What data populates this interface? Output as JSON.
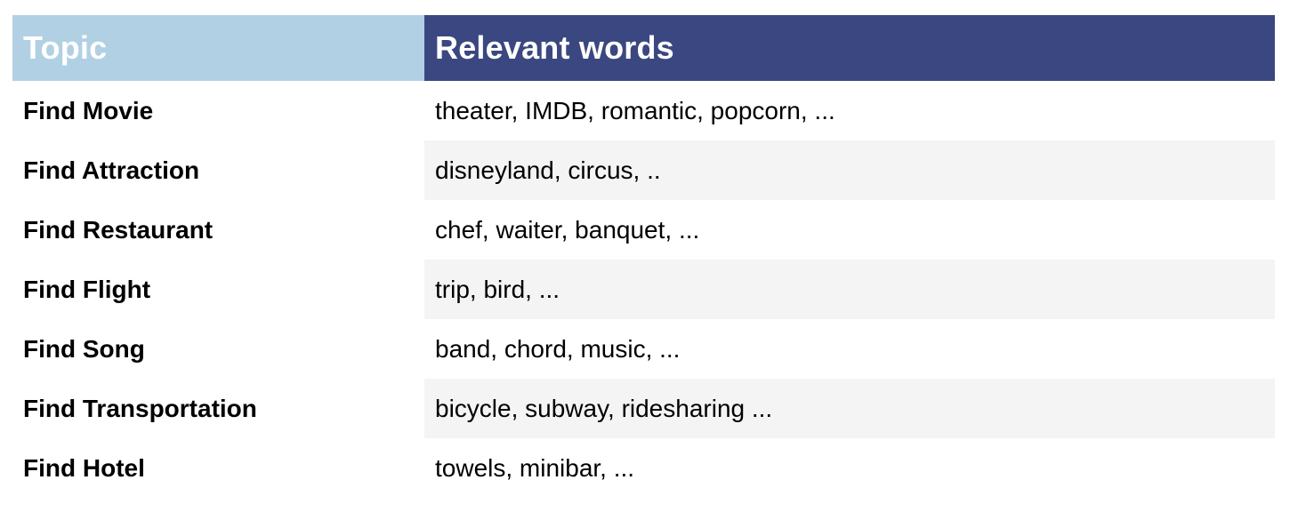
{
  "table": {
    "header": {
      "topic": "Topic",
      "words": "Relevant words"
    },
    "rows": [
      {
        "topic": "Find Movie",
        "words": "theater, IMDB, romantic, popcorn, ..."
      },
      {
        "topic": "Find Attraction",
        "words": "disneyland, circus, .."
      },
      {
        "topic": "Find Restaurant",
        "words": "chef, waiter, banquet, ..."
      },
      {
        "topic": "Find Flight",
        "words": "trip, bird, ..."
      },
      {
        "topic": "Find Song",
        "words": "band, chord, music, ..."
      },
      {
        "topic": "Find Transportation",
        "words": "bicycle, subway, ridesharing ..."
      },
      {
        "topic": "Find Hotel",
        "words": "towels, minibar, ..."
      }
    ]
  },
  "colors": {
    "header_topic_bg": "#b2d0e4",
    "header_words_bg": "#3b4780",
    "shaded_row_bg": "#f4f4f4"
  }
}
